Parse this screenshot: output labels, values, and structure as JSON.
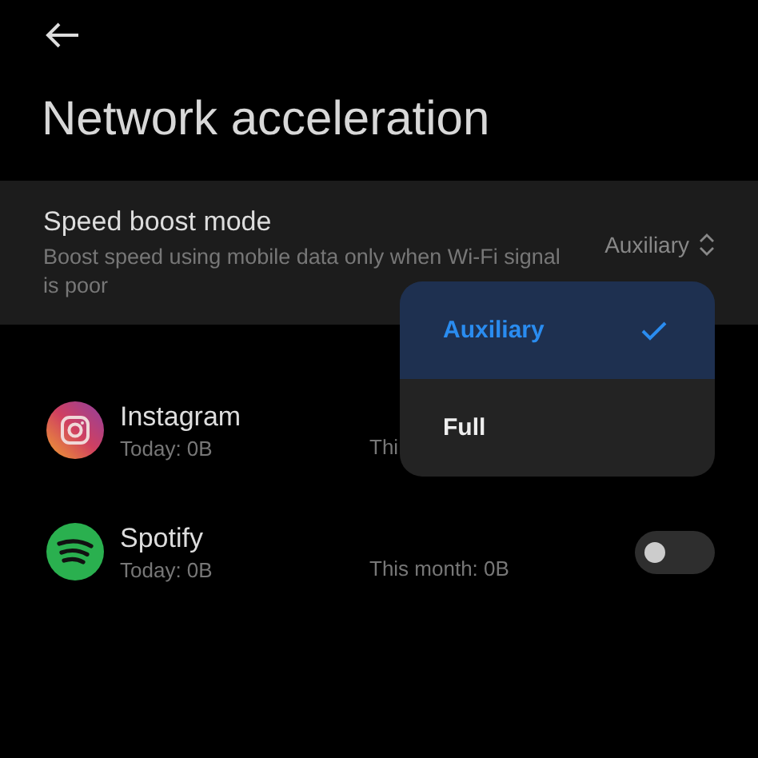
{
  "header": {
    "title": "Network acceleration"
  },
  "setting": {
    "title": "Speed boost mode",
    "description": "Boost speed using mobile data only when Wi-Fi signal is poor",
    "value": "Auxiliary"
  },
  "apps": [
    {
      "name": "Instagram",
      "today": "Today: 0B",
      "month": "Thi"
    },
    {
      "name": "Spotify",
      "today": "Today: 0B",
      "month": "This month: 0B",
      "toggle": {
        "on": false
      }
    }
  ],
  "dropdown": {
    "options": [
      {
        "label": "Auxiliary",
        "selected": true
      },
      {
        "label": "Full",
        "selected": false
      }
    ]
  }
}
